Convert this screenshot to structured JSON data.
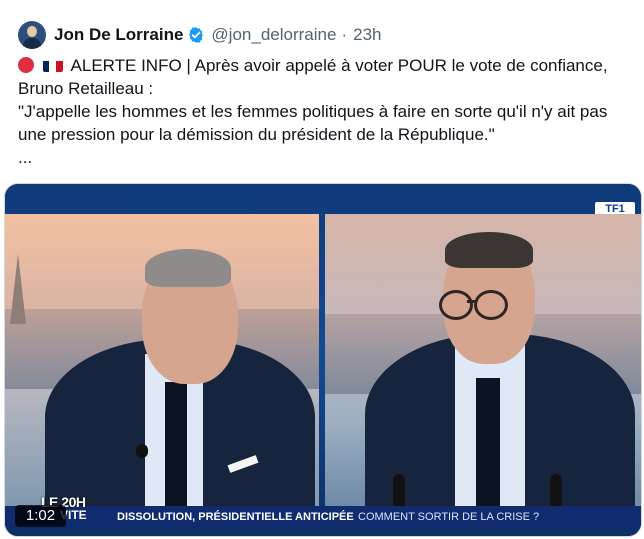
{
  "author": {
    "name": "Jon De Lorraine",
    "handle": "@jon_delorraine",
    "separator": "·",
    "time": "23h",
    "avatar_icon": "user-avatar",
    "verified_icon": "verified-badge-icon"
  },
  "post": {
    "alert_text": "ALERTE INFO | Après avoir appelé à voter POUR le vote de confiance,",
    "line2": "Bruno Retailleau :",
    "quote_line1": "\"J'appelle les hommes et les femmes politiques à faire en sorte qu'il n'y ait pas",
    "quote_line2": "une pression pour la démission du président de la République.\"",
    "ellipsis": "..."
  },
  "video": {
    "channel_logo": "TF1",
    "duration": "1:02",
    "program_logo_top": "LE 20H",
    "program_logo_bottom": "VITE",
    "ticker_text": "DISSOLUTION, PRÉSIDENTIELLE ANTICIPÉE",
    "ticker_subtext": "COMMENT SORTIR DE LA CRISE ?"
  },
  "colors": {
    "verified": "#1d9bf0",
    "text": "#0f1419",
    "muted": "#536471",
    "ticker_blue": "#102c6e"
  }
}
